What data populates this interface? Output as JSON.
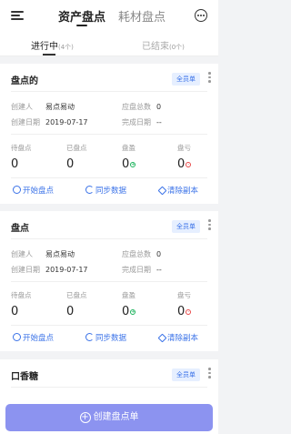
{
  "header": {
    "tabs": [
      {
        "label": "资产盘点"
      },
      {
        "label": "耗材盘点"
      }
    ]
  },
  "subtabs": [
    {
      "label": "进行中",
      "count": "(4个)"
    },
    {
      "label": "已结束",
      "count": "(0个)"
    }
  ],
  "labels": {
    "creator": "创建人",
    "create_date": "创建日期",
    "should_total": "应盘总数",
    "finish_date": "完成日期",
    "pending": "待盘点",
    "done": "已盘点",
    "profit": "盘盈",
    "loss": "盘亏",
    "start": "开始盘点",
    "sync": "同步数据",
    "clear": "清除副本"
  },
  "cards": [
    {
      "title": "盘点的",
      "badge": "全员单",
      "creator": "易点易动",
      "create_date": "2019-07-17",
      "should_total": "0",
      "finish_date": "--",
      "pending": "0",
      "done": "0",
      "profit": "0",
      "loss": "0"
    },
    {
      "title": "盘点",
      "badge": "全员单",
      "creator": "易点易动",
      "create_date": "2019-07-17",
      "should_total": "0",
      "finish_date": "--",
      "pending": "0",
      "done": "0",
      "profit": "0",
      "loss": "0"
    },
    {
      "title": "口香糖",
      "badge": "全员单"
    }
  ],
  "create_button": "创建盘点单",
  "colors": {
    "accent": "#3a72e8",
    "button": "#8c93f0",
    "profit": "#19b25a",
    "loss": "#e84848"
  }
}
